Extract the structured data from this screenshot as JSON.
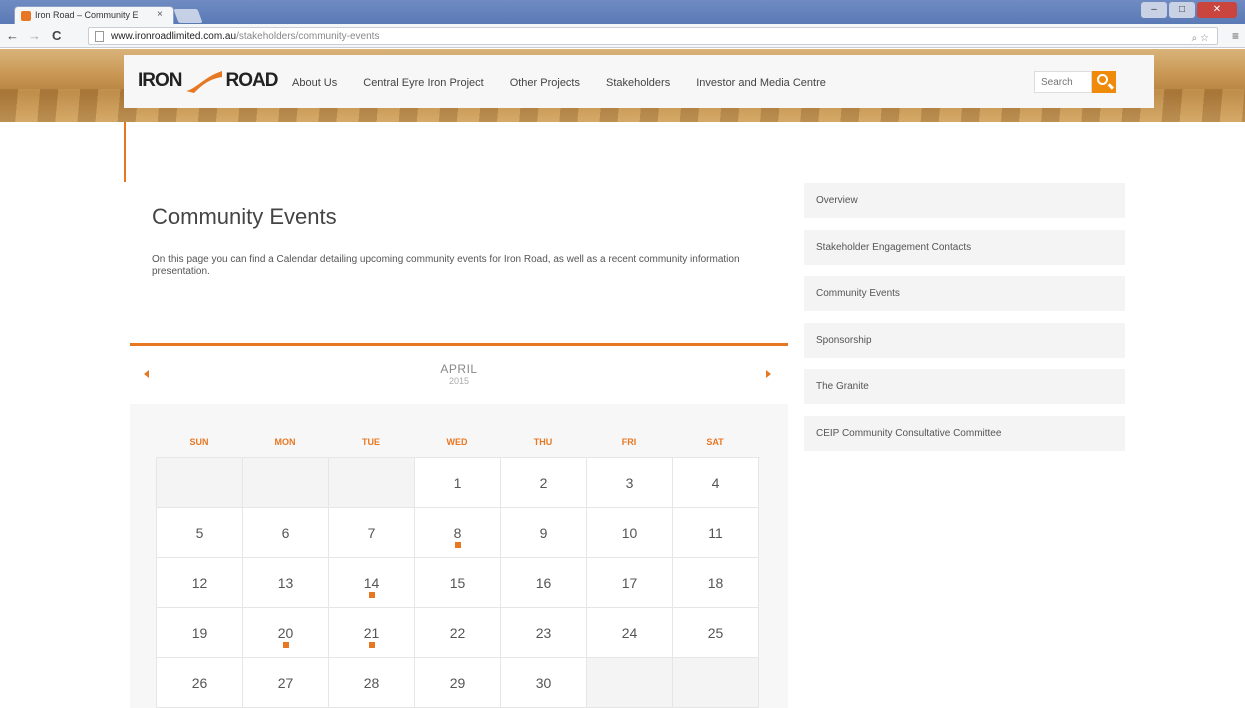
{
  "browser": {
    "tab_title": "Iron Road – Community E",
    "tab_close": "×",
    "url_domain": "www.ironroadlimited.com.au",
    "url_path": "/stakeholders/community-events"
  },
  "header": {
    "logo_iron": "IRON",
    "logo_road": "ROAD",
    "nav": [
      "About Us",
      "Central Eyre Iron Project",
      "Other Projects",
      "Stakeholders",
      "Investor and Media Centre"
    ],
    "search_placeholder": "Search"
  },
  "main": {
    "title": "Community Events",
    "intro": "On this page you can find a Calendar detailing upcoming community events for Iron Road, as well as a recent community information presentation."
  },
  "calendar": {
    "month": "APRIL",
    "year": "2015",
    "days_of_week": [
      "SUN",
      "MON",
      "TUE",
      "WED",
      "THU",
      "FRI",
      "SAT"
    ],
    "weeks": [
      [
        "",
        "",
        "",
        "1",
        "2",
        "3",
        "4"
      ],
      [
        "5",
        "6",
        "7",
        "8",
        "9",
        "10",
        "11"
      ],
      [
        "12",
        "13",
        "14",
        "15",
        "16",
        "17",
        "18"
      ],
      [
        "19",
        "20",
        "21",
        "22",
        "23",
        "24",
        "25"
      ],
      [
        "26",
        "27",
        "28",
        "29",
        "30",
        "",
        ""
      ]
    ],
    "event_days": [
      "8",
      "14",
      "20",
      "21"
    ]
  },
  "sidebar": {
    "items": [
      "Overview",
      "Stakeholder Engagement Contacts",
      "Community Events",
      "Sponsorship",
      "The Granite",
      "CEIP Community Consultative Committee"
    ]
  },
  "colors": {
    "accent": "#e87722"
  }
}
